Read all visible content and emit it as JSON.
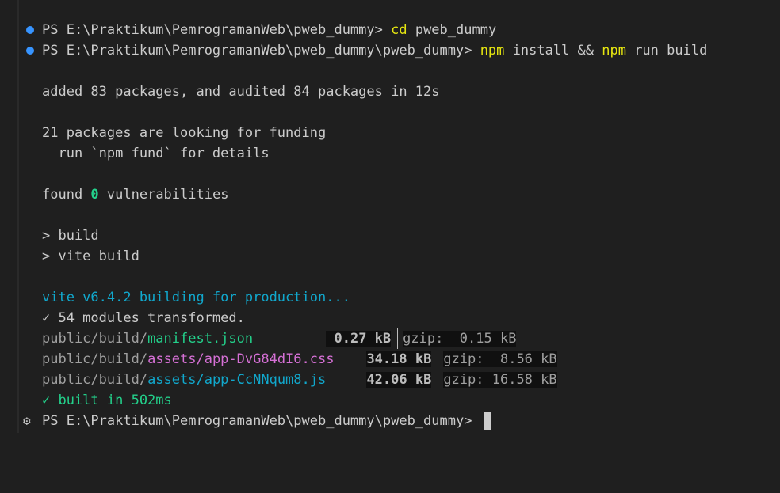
{
  "terminal": {
    "line1_prompt": "PS E:\\Praktikum\\PemrogramanWeb\\pweb_dummy> ",
    "line1_cmd": "cd",
    "line1_args": " pweb_dummy",
    "line2_prompt": "PS E:\\Praktikum\\PemrogramanWeb\\pweb_dummy\\pweb_dummy> ",
    "line2_npm1": "npm",
    "line2_mid": " install && ",
    "line2_npm2": "npm",
    "line2_end": " run build",
    "added": "added 83 packages, and audited 84 packages in 12s",
    "funding1": "21 packages are looking for funding",
    "funding2": "  run `npm fund` for details",
    "found_pre": "found ",
    "found_count": "0",
    "found_post": " vulnerabilities",
    "script1": "> build",
    "script2": "> vite build",
    "vite_line": "vite v6.4.2 building for production...",
    "transformed": "✓ 54 modules transformed.",
    "outputs": [
      {
        "dir": "public/build/",
        "file": "manifest.json",
        "pad": "      ",
        "size": " 0.27 kB",
        "gzip": "gzip:  0.15 kB",
        "color": "#23d18b"
      },
      {
        "dir": "public/build/",
        "file": "assets/app-DvG84dI6.css",
        "pad": " ",
        "size": "34.18 kB",
        "gzip": "gzip:  8.56 kB",
        "color": "#d670d6"
      },
      {
        "dir": "public/build/",
        "file": "assets/app-CcNNqum8.js",
        "pad": "  ",
        "size": "42.06 kB",
        "gzip": "gzip: 16.58 kB",
        "color": "#11a8cd"
      }
    ],
    "built": "✓ built in 502ms",
    "final_prompt": "PS E:\\Praktikum\\PemrogramanWeb\\pweb_dummy\\pweb_dummy> "
  },
  "icons": {
    "decoration_success": "circle-decoration-icon",
    "decoration_current": "sparkle-gear-icon"
  },
  "colors": {
    "background": "#1f1f1f",
    "foreground": "#cccccc",
    "decoration_blue": "#3794ff",
    "yellow": "#e5e510",
    "green": "#23d18b",
    "cyan": "#11a8cd",
    "magenta": "#d670d6"
  }
}
